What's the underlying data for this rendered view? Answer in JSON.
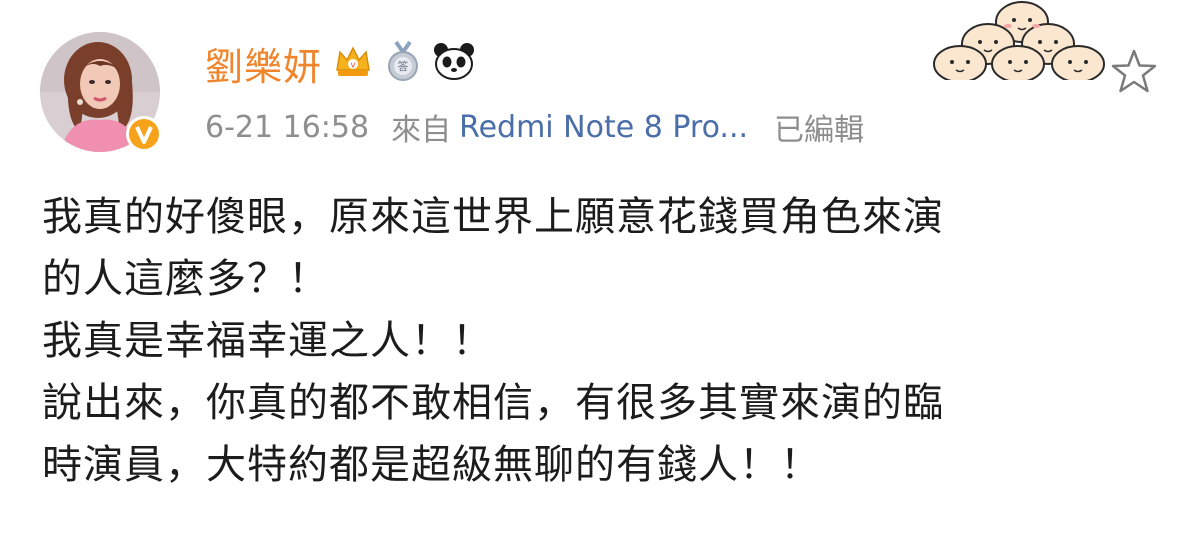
{
  "post": {
    "author": {
      "name": "劉樂妍",
      "avatar_icon": "avatar-photo",
      "verified_icon": "verified-v-badge",
      "badges": [
        "crown-icon",
        "medal-icon",
        "panda-icon"
      ]
    },
    "meta": {
      "time": "6-21 16:58",
      "source_label": "來自",
      "source_device": "Redmi Note 8 Pro...",
      "edited": "已編輯"
    },
    "decoration_icon": "bean-characters-sticker",
    "favorite_icon": "star-icon",
    "content": {
      "lines": [
        "我真的好傻眼，原來這世界上願意花錢買角色來演",
        "的人這麼多？！",
        "我真是幸福幸運之人！！",
        "說出來，你真的都不敢相信，有很多其實來演的臨",
        "時演員，大特約都是超級無聊的有錢人！！"
      ]
    },
    "colors": {
      "username": "#f0852c",
      "meta_text": "#8e8e8e",
      "source_link": "#4a6ea8",
      "body_text": "#1c1c1c",
      "verified_badge": "#f7a21b"
    }
  }
}
